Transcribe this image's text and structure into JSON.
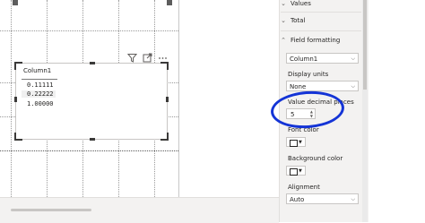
{
  "table": {
    "header": "Column1",
    "rows": [
      "0.11111",
      "0.22222",
      "1.00000"
    ]
  },
  "visual_header_icons": [
    "filter-icon",
    "focus-mode-icon",
    "more-options-icon"
  ],
  "pane": {
    "sections": {
      "values": "Values",
      "total": "Total",
      "field_formatting": "Field formatting"
    },
    "column_select": "Column1",
    "display_units_label": "Display units",
    "display_units_value": "None",
    "decimal_places_label": "Value decimal places",
    "decimal_places_value": "5",
    "font_color_label": "Font color",
    "background_color_label": "Background color",
    "alignment_label": "Alignment",
    "alignment_value": "Auto"
  },
  "colors": {
    "annotation_circle": "#1434d6",
    "pane_background": "#f3f2f1"
  }
}
